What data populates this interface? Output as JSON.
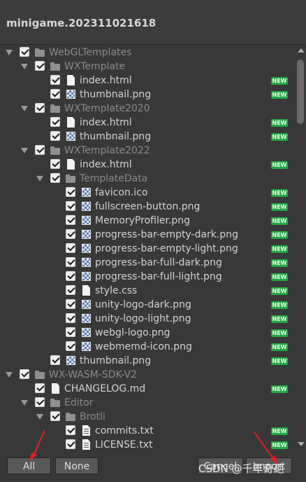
{
  "window": {
    "title": "minigame.202311021618"
  },
  "badge_text": "NEW",
  "tree": [
    {
      "label": "WebGLTemplates",
      "type": "folder",
      "depth": 0,
      "fold": true,
      "dim": true,
      "new": false
    },
    {
      "label": "WXTemplate",
      "type": "folder",
      "depth": 1,
      "fold": true,
      "dim": true,
      "new": false
    },
    {
      "label": "index.html",
      "type": "file",
      "depth": 2,
      "fold": false,
      "dim": false,
      "new": true
    },
    {
      "label": "thumbnail.png",
      "type": "image",
      "depth": 2,
      "fold": false,
      "dim": false,
      "new": true
    },
    {
      "label": "WXTemplate2020",
      "type": "folder",
      "depth": 1,
      "fold": true,
      "dim": true,
      "new": false
    },
    {
      "label": "index.html",
      "type": "file",
      "depth": 2,
      "fold": false,
      "dim": false,
      "new": true
    },
    {
      "label": "thumbnail.png",
      "type": "image",
      "depth": 2,
      "fold": false,
      "dim": false,
      "new": true
    },
    {
      "label": "WXTemplate2022",
      "type": "folder",
      "depth": 1,
      "fold": true,
      "dim": true,
      "new": false
    },
    {
      "label": "index.html",
      "type": "file",
      "depth": 2,
      "fold": false,
      "dim": false,
      "new": true
    },
    {
      "label": "TemplateData",
      "type": "folder",
      "depth": 2,
      "fold": true,
      "dim": true,
      "new": false
    },
    {
      "label": "favicon.ico",
      "type": "image",
      "depth": 3,
      "fold": false,
      "dim": false,
      "new": true
    },
    {
      "label": "fullscreen-button.png",
      "type": "image",
      "depth": 3,
      "fold": false,
      "dim": false,
      "new": true
    },
    {
      "label": "MemoryProfiler.png",
      "type": "image",
      "depth": 3,
      "fold": false,
      "dim": false,
      "new": true
    },
    {
      "label": "progress-bar-empty-dark.png",
      "type": "image",
      "depth": 3,
      "fold": false,
      "dim": false,
      "new": true
    },
    {
      "label": "progress-bar-empty-light.png",
      "type": "image",
      "depth": 3,
      "fold": false,
      "dim": false,
      "new": true
    },
    {
      "label": "progress-bar-full-dark.png",
      "type": "image",
      "depth": 3,
      "fold": false,
      "dim": false,
      "new": true
    },
    {
      "label": "progress-bar-full-light.png",
      "type": "image",
      "depth": 3,
      "fold": false,
      "dim": false,
      "new": true
    },
    {
      "label": "style.css",
      "type": "file",
      "depth": 3,
      "fold": false,
      "dim": false,
      "new": true
    },
    {
      "label": "unity-logo-dark.png",
      "type": "image",
      "depth": 3,
      "fold": false,
      "dim": false,
      "new": true
    },
    {
      "label": "unity-logo-light.png",
      "type": "image",
      "depth": 3,
      "fold": false,
      "dim": false,
      "new": true
    },
    {
      "label": "webgl-logo.png",
      "type": "image",
      "depth": 3,
      "fold": false,
      "dim": false,
      "new": true
    },
    {
      "label": "webmemd-icon.png",
      "type": "image",
      "depth": 3,
      "fold": false,
      "dim": false,
      "new": true
    },
    {
      "label": "thumbnail.png",
      "type": "image",
      "depth": 2,
      "fold": false,
      "dim": false,
      "new": true
    },
    {
      "label": "WX-WASM-SDK-V2",
      "type": "folder",
      "depth": 0,
      "fold": true,
      "dim": true,
      "new": false
    },
    {
      "label": "CHANGELOG.md",
      "type": "file",
      "depth": 1,
      "fold": false,
      "dim": false,
      "new": true
    },
    {
      "label": "Editor",
      "type": "folder",
      "depth": 1,
      "fold": true,
      "dim": true,
      "new": false
    },
    {
      "label": "Brotli",
      "type": "folder",
      "depth": 2,
      "fold": true,
      "dim": true,
      "new": false
    },
    {
      "label": "commits.txt",
      "type": "text",
      "depth": 3,
      "fold": false,
      "dim": false,
      "new": true
    },
    {
      "label": "LICENSE.txt",
      "type": "text",
      "depth": 3,
      "fold": false,
      "dim": false,
      "new": true
    }
  ],
  "buttons": {
    "all": "All",
    "none": "None",
    "cancel": "Cancel",
    "import": "Import"
  },
  "watermark": "CSDN @千年奇葩",
  "colors": {
    "new_badge": "#26a745",
    "arrow": "#e02020",
    "background": "#383838"
  }
}
